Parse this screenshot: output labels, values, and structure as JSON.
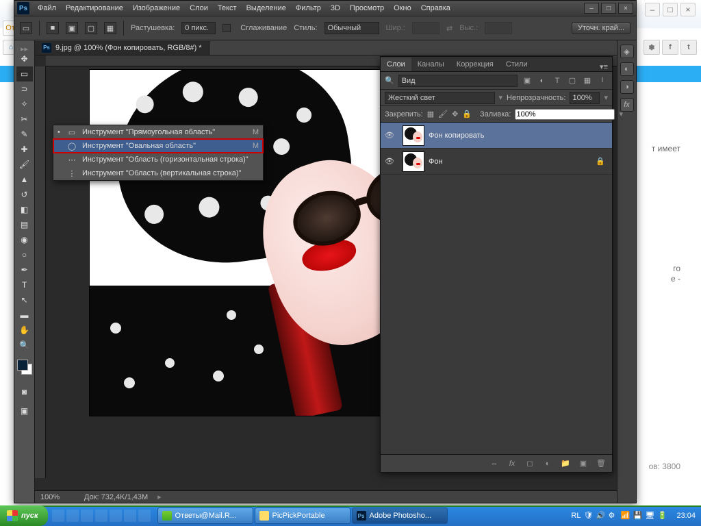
{
  "menubar": [
    "Файл",
    "Редактирование",
    "Изображение",
    "Слои",
    "Текст",
    "Выделение",
    "Фильтр",
    "3D",
    "Просмотр",
    "Окно",
    "Справка"
  ],
  "options": {
    "feather_label": "Растушевка:",
    "feather_value": "0 пикс.",
    "antialias": "Сглаживание",
    "style_label": "Стиль:",
    "style_value": "Обычный",
    "width_label": "Шир.:",
    "height_label": "Выс.:",
    "refine": "Уточн. край..."
  },
  "doc": {
    "tab": "9.jpg @ 100% (Фон копировать, RGB/8#) *",
    "zoom": "100%",
    "docsize": "Док: 732,4K/1,43M"
  },
  "flyout": {
    "items": [
      {
        "icon": "▭",
        "label": "Инструмент \"Прямоугольная область\"",
        "key": "M",
        "sel": true
      },
      {
        "icon": "◯",
        "label": "Инструмент \"Овальная область\"",
        "key": "M",
        "hili": true
      },
      {
        "icon": "⋯",
        "label": "Инструмент \"Область (горизонтальная строка)\"",
        "key": ""
      },
      {
        "icon": "⋮",
        "label": "Инструмент \"Область (вертикальная строка)\"",
        "key": ""
      }
    ]
  },
  "panels": {
    "tabs": [
      "Слои",
      "Каналы",
      "Коррекция",
      "Стили"
    ],
    "filter": "Вид",
    "blend_mode": "Жесткий свет",
    "opacity_label": "Непрозрачность:",
    "opacity": "100%",
    "lock_label": "Закрепить:",
    "fill_label": "Заливка:",
    "fill": "100%",
    "layers": [
      {
        "name": "Фон копировать",
        "sel": true,
        "locked": false
      },
      {
        "name": "Фон",
        "sel": false,
        "locked": true
      }
    ]
  },
  "bg": {
    "views": "ов: 3800",
    "text1": "т имеет",
    "text2": "го",
    "text3": "е -",
    "answ": "От"
  },
  "taskbar": {
    "start": "пуск",
    "tasks": [
      {
        "label": "Ответы@Mail.R...",
        "active": false
      },
      {
        "label": "PicPickPortable",
        "active": false
      },
      {
        "label": "Adobe Photosho...",
        "active": true
      }
    ],
    "lang": "RL",
    "time": "23:04"
  }
}
